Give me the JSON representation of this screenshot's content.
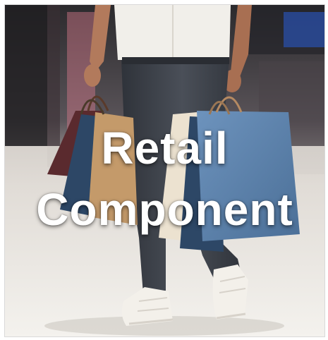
{
  "title": {
    "line1": "Retail",
    "line2": "Component"
  },
  "photo": {
    "subject": "shopper-with-bags",
    "colors": {
      "background_dark": "#2b2a2d",
      "floor": "#e9e6e1",
      "shirt": "#f1efea",
      "jeans": "#3b3f47",
      "skin": "#b27a5c",
      "bag_blue": "#5a7fa8",
      "bag_navy": "#2d4766",
      "bag_tan": "#c49a6a",
      "bag_cream": "#ece2d0",
      "bag_maroon": "#5a2a2e",
      "shoes": "#f3f0ea",
      "accent_pink": "#d77a8b",
      "accent_blue": "#2a4fa8"
    }
  }
}
